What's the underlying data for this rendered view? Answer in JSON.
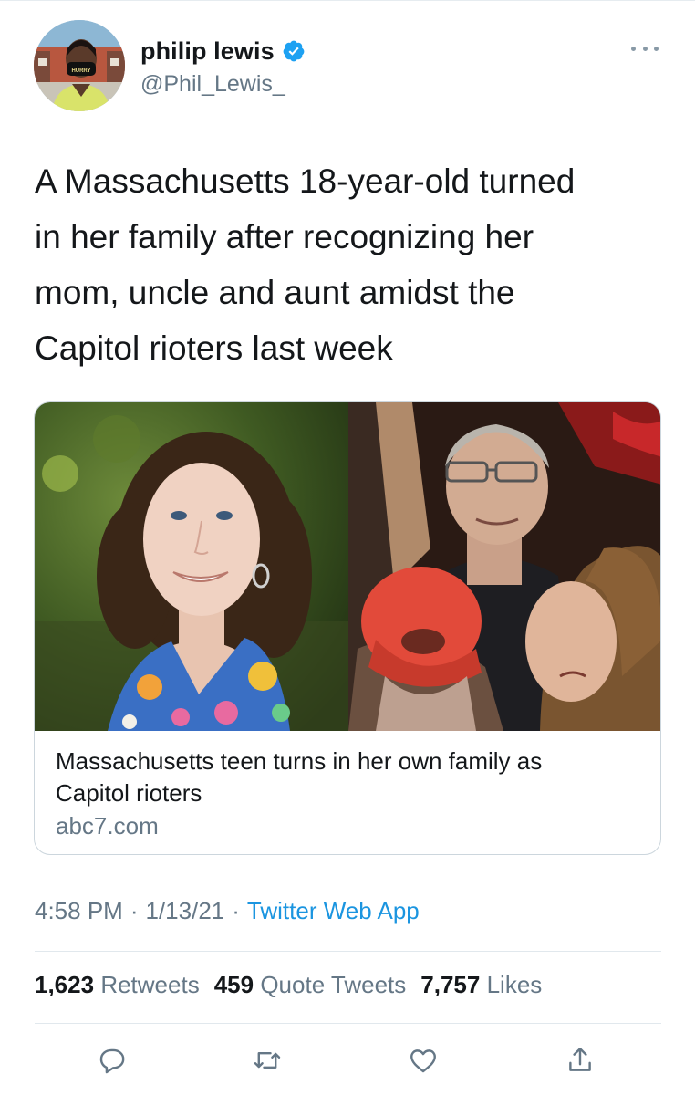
{
  "user": {
    "display_name": "philip lewis",
    "handle": "@Phil_Lewis_",
    "verified_icon": "verified-badge-icon",
    "mask_text": "HURRY"
  },
  "tweet": {
    "text": "A Massachusetts 18-year-old turned\nin her family after recognizing her\nmom, uncle and aunt amidst the\nCapitol rioters last week"
  },
  "card": {
    "title": "Massachusetts teen turns in her own family as\nCapitol rioters",
    "domain": "abc7.com"
  },
  "meta": {
    "time": "4:58 PM",
    "date": "1/13/21",
    "source": "Twitter Web App",
    "separator": "·"
  },
  "stats": {
    "retweets_count": "1,623",
    "retweets_label": "Retweets",
    "quotes_count": "459",
    "quotes_label": "Quote Tweets",
    "likes_count": "7,757",
    "likes_label": "Likes"
  },
  "actions": [
    "reply-icon",
    "retweet-icon",
    "like-icon",
    "share-icon"
  ],
  "colors": {
    "text": "#14171a",
    "secondary": "#657786",
    "link": "#1b95e0",
    "verified": "#1da1f2",
    "border": "#ccd6dd"
  }
}
